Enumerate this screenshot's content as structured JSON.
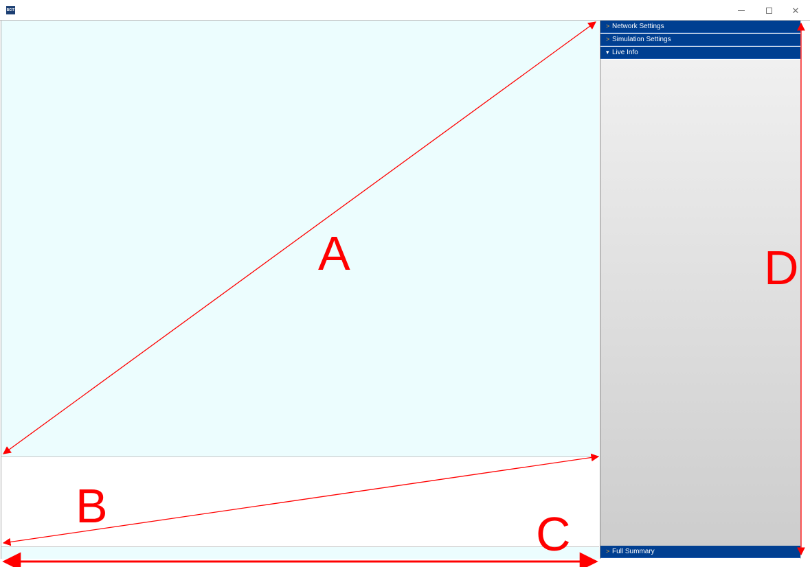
{
  "titlebar": {
    "icon_text": "BCIT",
    "minimize_symbol": "",
    "close_symbol": "✕"
  },
  "sidebar": {
    "sections": [
      {
        "label": "Network Settings",
        "state": "collapsed",
        "chevron": ">"
      },
      {
        "label": "Simulation Settings",
        "state": "collapsed",
        "chevron": ">"
      },
      {
        "label": "Live Info",
        "state": "expanded",
        "chevron": "▾"
      },
      {
        "label": "Full Summary",
        "state": "collapsed",
        "chevron": ">"
      }
    ]
  },
  "annotations": {
    "a": "A",
    "b": "B",
    "c": "C",
    "d": "D",
    "color": "#ff0000"
  },
  "colors": {
    "canvas": "#ecfdfe",
    "header": "#003f91",
    "chevron": "#e8a63a"
  }
}
